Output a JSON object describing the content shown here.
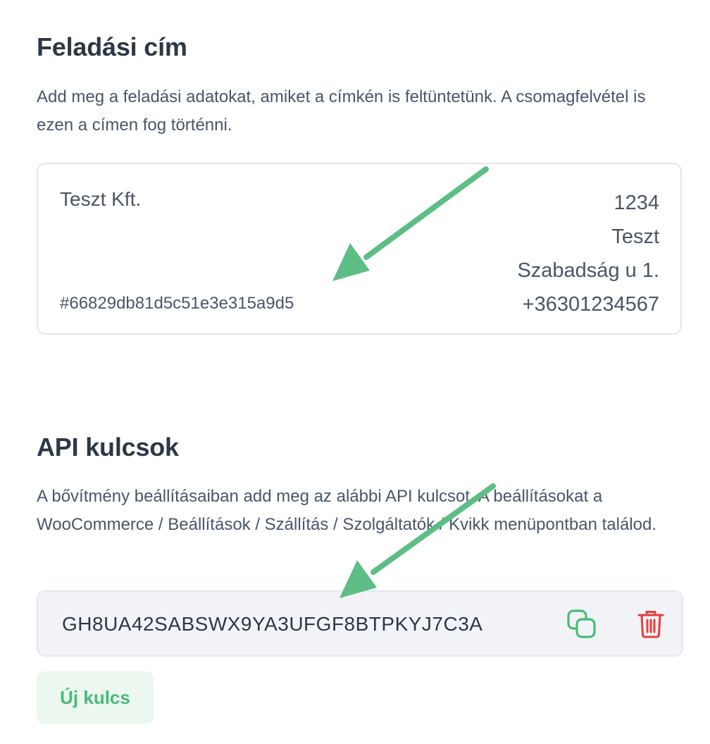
{
  "sender_section": {
    "title": "Feladási cím",
    "description": "Add meg a feladási adatokat, amiket a címkén is feltüntetünk. A csomagfelvétel is ezen a címen fog történni.",
    "address": {
      "company": "Teszt Kft.",
      "order_id": "#66829db81d5c51e3e315a9d5",
      "postal_code": "1234",
      "city": "Teszt",
      "street": "Szabadság u 1.",
      "phone": "+36301234567"
    }
  },
  "api_section": {
    "title": "API kulcsok",
    "description": "A bővítmény beállításaiban add meg az alábbi API kulcsot. A beállításokat a WooCommerce / Beállítások / Szállítás / Szolgáltatók / Kvikk menüpontban találod.",
    "api_key": "GH8UA42SABSWX9YA3UFGF8BTPKYJ7C3A",
    "copy_icon": "copy-icon",
    "delete_icon": "trash-icon",
    "new_key_label": "Új kulcs"
  },
  "colors": {
    "heading": "#2d3748",
    "body_text": "#4a5568",
    "accent_green": "#48bb78",
    "danger_red": "#e53e3e",
    "annotation_arrow": "#5dbe85"
  }
}
